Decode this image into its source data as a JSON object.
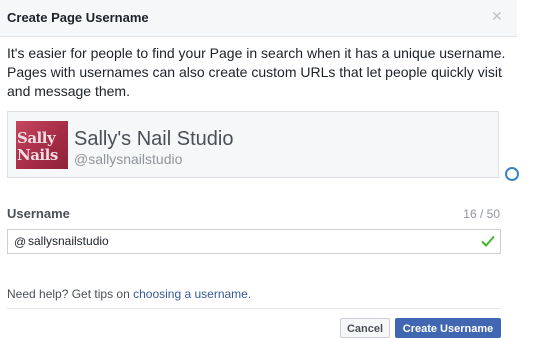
{
  "dialog": {
    "title": "Create Page Username",
    "close_icon": "close-icon",
    "intro": "It's easier for people to find your Page in search when it has a unique username. Pages with usernames can also create custom URLs that let people quickly visit and message them."
  },
  "page": {
    "photo_line1": "Sally",
    "photo_line2": "Nails",
    "name": "Sally's Nail Studio",
    "handle": "@sallysnailstudio"
  },
  "username": {
    "label": "Username",
    "count": "16 / 50",
    "prefix": "@",
    "value": "sallysnailstudio",
    "status_icon": "check-icon"
  },
  "help": {
    "text": "Need help? Get tips on ",
    "link": "choosing a username."
  },
  "buttons": {
    "cancel": "Cancel",
    "create": "Create Username"
  },
  "colors": {
    "primary": "#4267b2",
    "link": "#365899",
    "check": "#42b72a"
  }
}
